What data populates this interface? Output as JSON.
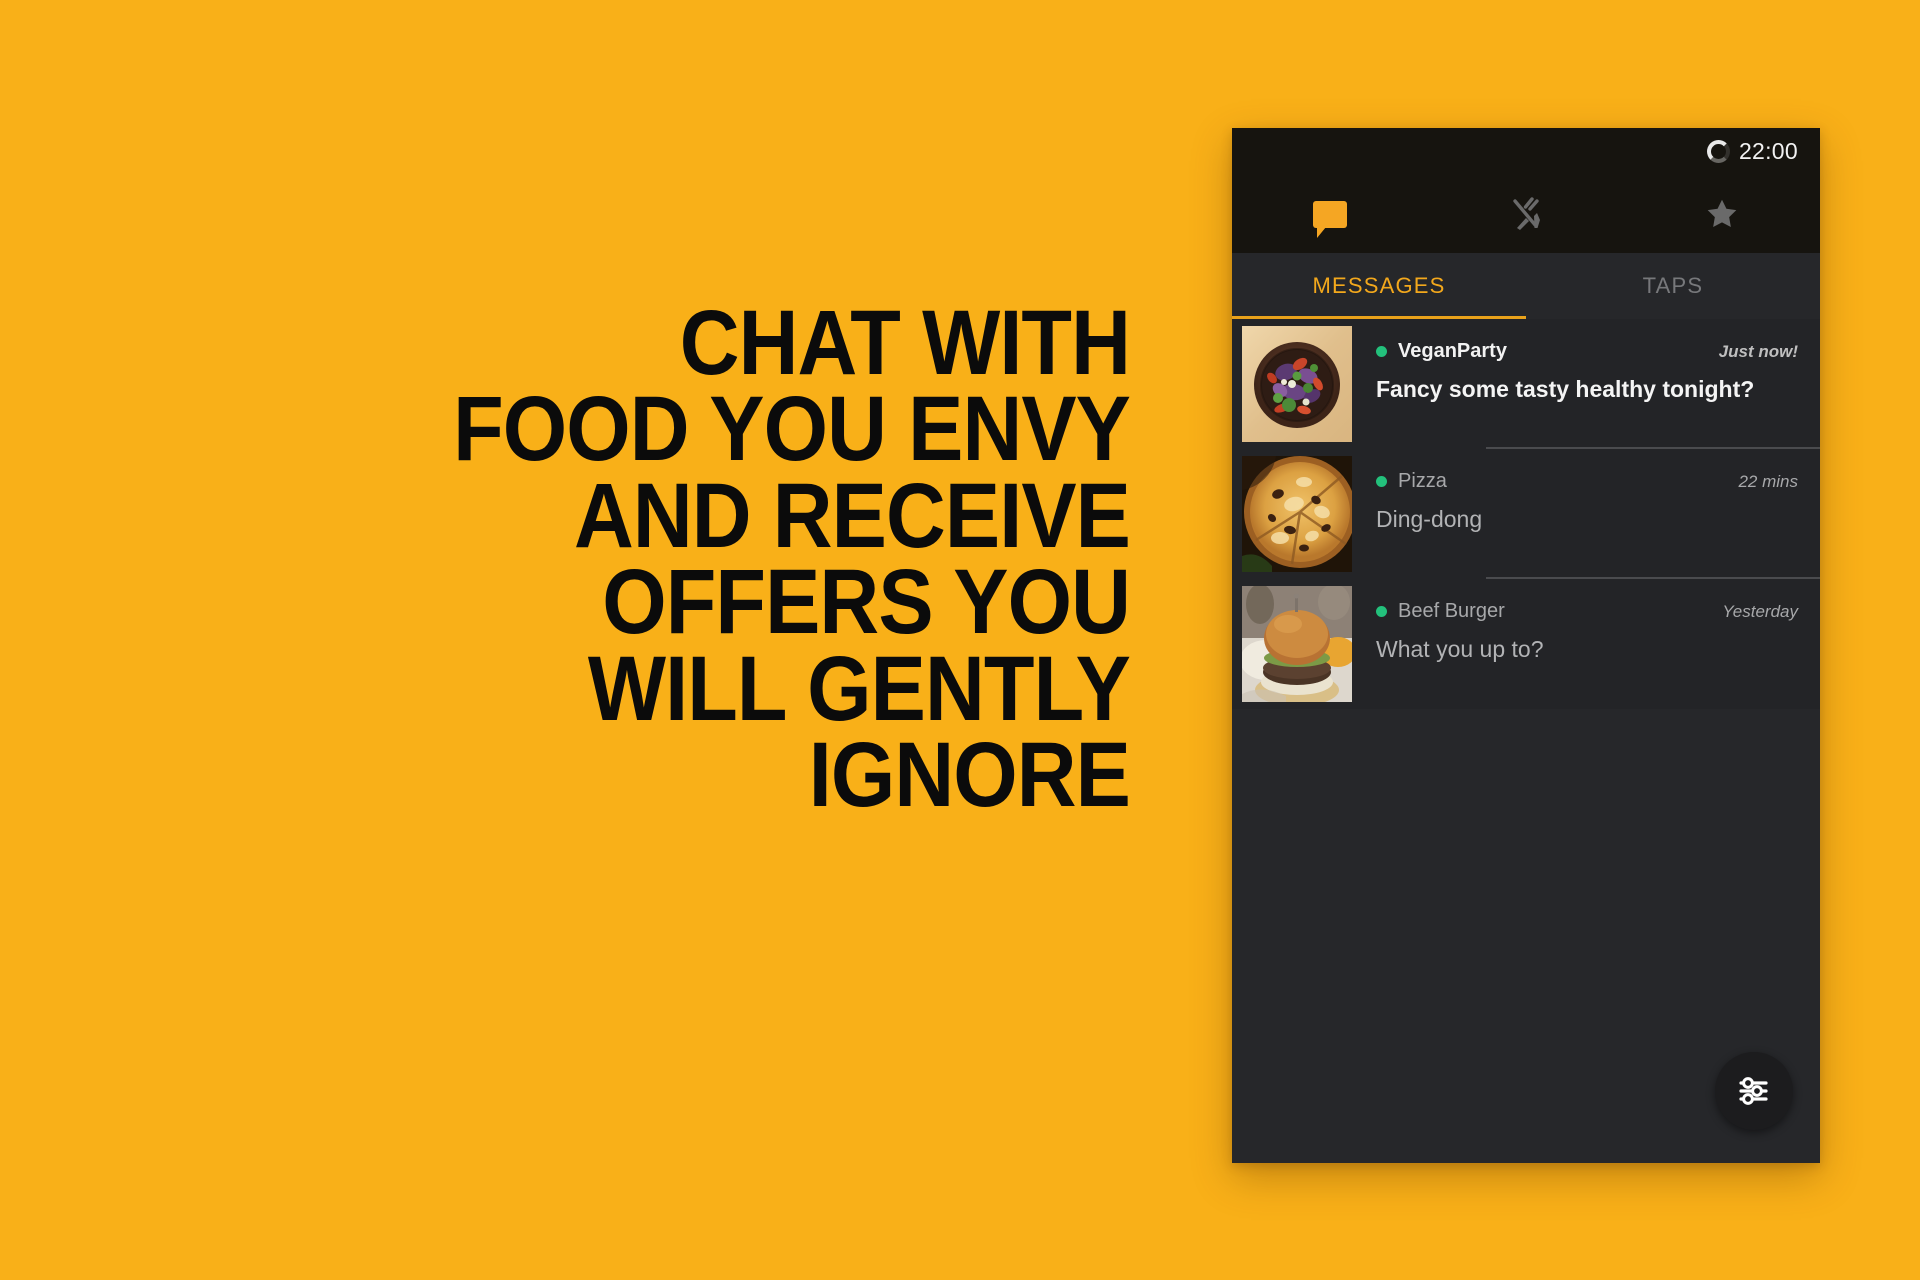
{
  "background_color": "#F9B018",
  "headline": {
    "lines": [
      "CHAT WITH",
      "FOOD YOU ENVY",
      "AND RECEIVE",
      "OFFERS YOU",
      "WILL GENTLY",
      "IGNORE"
    ],
    "color": "#0B0B0B"
  },
  "phone": {
    "status_bar": {
      "time": "22:00",
      "spinner_icon": "loading-spinner-icon"
    },
    "top_nav": {
      "items": [
        {
          "icon": "chat-bubble-icon",
          "active": true,
          "color": "#F5A623"
        },
        {
          "icon": "cutlery-icon",
          "active": false,
          "color": "#6A6A6A"
        },
        {
          "icon": "star-icon",
          "active": false,
          "color": "#6A6A6A"
        }
      ]
    },
    "tabs": {
      "active_color": "#F3A81C",
      "inactive_color": "#77787B",
      "items": [
        {
          "label": "MESSAGES",
          "active": true
        },
        {
          "label": "TAPS",
          "active": false
        }
      ]
    },
    "messages": [
      {
        "thumb": "salad-bowl-thumbnail",
        "status_dot_color": "#23C17C",
        "name": "VeganParty",
        "time": "Just now!",
        "preview": "Fancy some tasty healthy tonight?",
        "unread": true
      },
      {
        "thumb": "pizza-thumbnail",
        "status_dot_color": "#23C17C",
        "name": "Pizza",
        "time": "22 mins",
        "preview": "Ding-dong",
        "unread": false
      },
      {
        "thumb": "beef-burger-thumbnail",
        "status_dot_color": "#23C17C",
        "name": "Beef Burger",
        "time": "Yesterday",
        "preview": "What you up to?",
        "unread": false
      }
    ],
    "fab": {
      "icon": "sliders-filter-icon",
      "background": "#1C1C1E"
    }
  }
}
